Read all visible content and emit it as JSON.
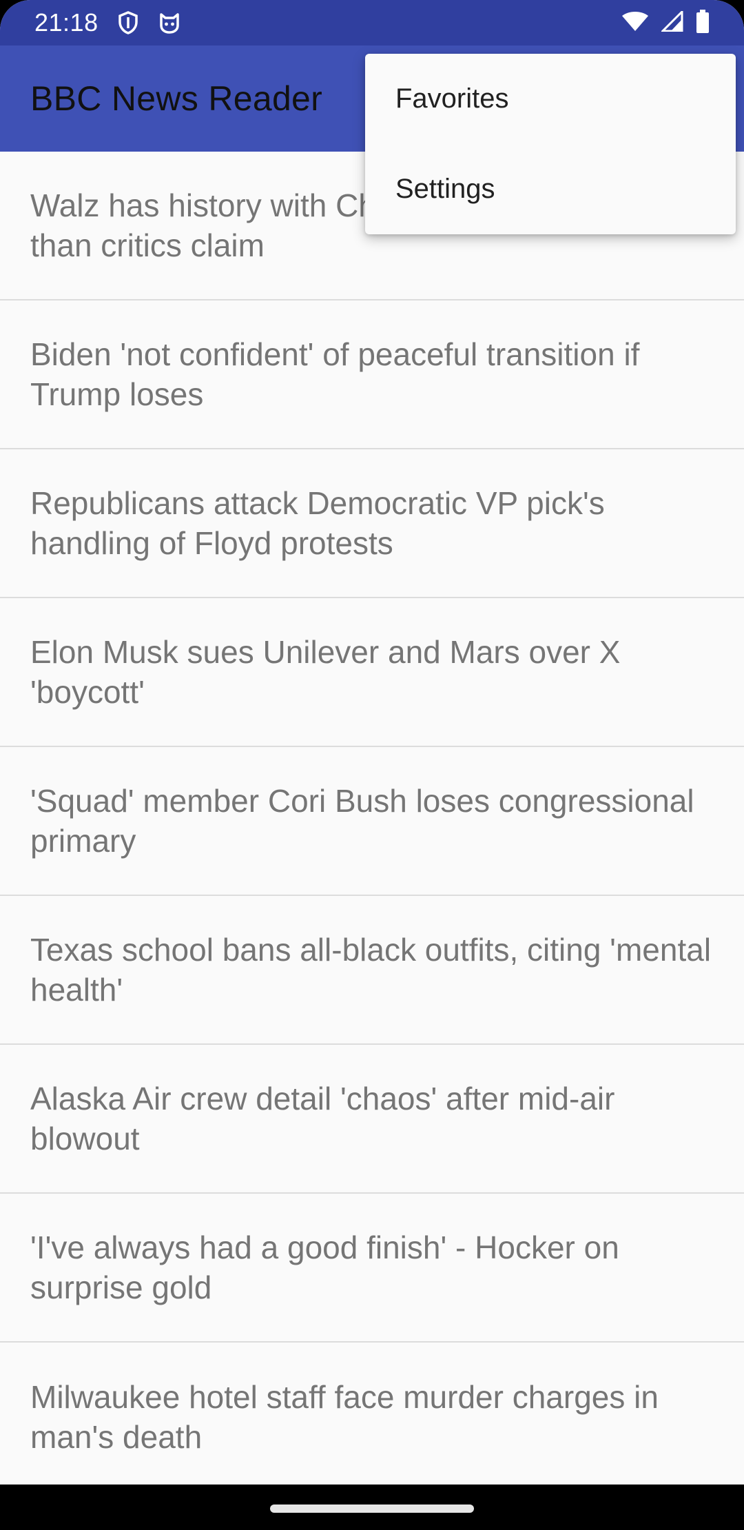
{
  "status_bar": {
    "time": "21:18",
    "icons_left": [
      "shield-icon",
      "cat-icon"
    ],
    "icons_right": [
      "wifi-icon",
      "signal-icon",
      "battery-icon"
    ]
  },
  "app_bar": {
    "title": "BBC News Reader"
  },
  "overflow_menu": {
    "items": [
      {
        "label": "Favorites"
      },
      {
        "label": "Settings"
      }
    ]
  },
  "news": {
    "items": [
      {
        "title": "Walz has history with China but is more hawkish than critics claim"
      },
      {
        "title": "Biden 'not confident' of peaceful transition if Trump loses"
      },
      {
        "title": "Republicans attack Democratic VP pick's handling of Floyd protests"
      },
      {
        "title": "Elon Musk sues Unilever and Mars over X 'boycott'"
      },
      {
        "title": "'Squad' member Cori Bush loses congressional primary"
      },
      {
        "title": "Texas school bans all-black outfits, citing 'mental health'"
      },
      {
        "title": "Alaska Air crew detail 'chaos' after mid-air blowout"
      },
      {
        "title": "'I've always had a good finish' - Hocker on surprise gold"
      },
      {
        "title": "Milwaukee hotel staff face murder charges in man's death"
      }
    ]
  },
  "colors": {
    "status_bar": "#303f9f",
    "app_bar": "#3f51b5",
    "background": "#fafafa",
    "news_text": "#757575",
    "divider": "#dcdcdc"
  }
}
